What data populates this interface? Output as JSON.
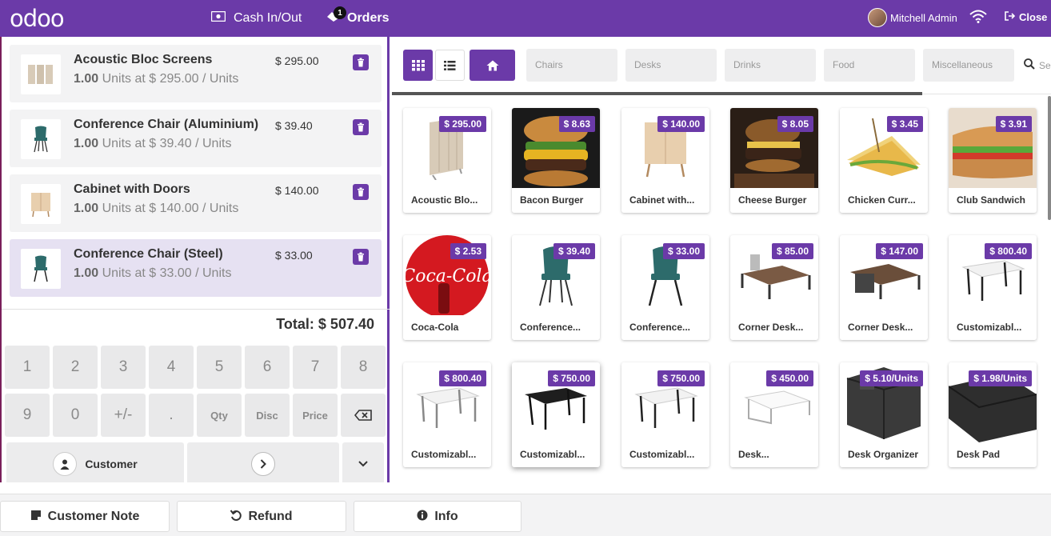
{
  "header": {
    "logo": "odoo",
    "cash_label": "Cash In/Out",
    "orders_label": "Orders",
    "orders_count": "1",
    "user_name": "Mitchell Admin",
    "close_label": "Close"
  },
  "order": {
    "lines": [
      {
        "name": "Acoustic Bloc Screens",
        "qty": "1.00",
        "unit_text": "Units at $ 295.00 / Units",
        "price": "$ 295.00",
        "selected": false
      },
      {
        "name": "Conference Chair (Aluminium)",
        "qty": "1.00",
        "unit_text": "Units at $ 39.40 / Units",
        "price": "$ 39.40",
        "selected": false
      },
      {
        "name": "Cabinet with Doors",
        "qty": "1.00",
        "unit_text": "Units at $ 140.00 / Units",
        "price": "$ 140.00",
        "selected": false
      },
      {
        "name": "Conference Chair (Steel)",
        "qty": "1.00",
        "unit_text": "Units at $ 33.00 / Units",
        "price": "$ 33.00",
        "selected": true
      }
    ],
    "total": "Total: $ 507.40"
  },
  "numpad": {
    "row1": [
      "1",
      "2",
      "3",
      "4",
      "5",
      "6",
      "7",
      "8"
    ],
    "row2": [
      "9",
      "0",
      "+/-",
      ".",
      "Qty",
      "Disc",
      "Price"
    ],
    "customer_label": "Customer"
  },
  "bottom": {
    "note_label": "Customer Note",
    "refund_label": "Refund",
    "info_label": "Info"
  },
  "categories": [
    "Chairs",
    "Desks",
    "Drinks",
    "Food",
    "Miscellaneous"
  ],
  "search_placeholder": "Se",
  "products": [
    {
      "name": "Acoustic Blo...",
      "price": "$ 295.00",
      "icon": "screen-icon"
    },
    {
      "name": "Bacon Burger",
      "price": "$ 8.63",
      "icon": "burger-icon"
    },
    {
      "name": "Cabinet with...",
      "price": "$ 140.00",
      "icon": "cabinet-icon"
    },
    {
      "name": "Cheese Burger",
      "price": "$ 8.05",
      "icon": "burger-icon"
    },
    {
      "name": "Chicken Curr...",
      "price": "$ 3.45",
      "icon": "sandwich-icon"
    },
    {
      "name": "Club Sandwich",
      "price": "$ 3.91",
      "icon": "sandwich-icon"
    },
    {
      "name": "Coca-Cola",
      "price": "$ 2.53",
      "icon": "cola-icon"
    },
    {
      "name": "Conference...",
      "price": "$ 39.40",
      "icon": "chair-icon"
    },
    {
      "name": "Conference...",
      "price": "$ 33.00",
      "icon": "chair-icon"
    },
    {
      "name": "Corner Desk...",
      "price": "$ 85.00",
      "icon": "desk-icon"
    },
    {
      "name": "Corner Desk...",
      "price": "$ 147.00",
      "icon": "desk-icon"
    },
    {
      "name": "Customizabl...",
      "price": "$ 800.40",
      "icon": "table-icon"
    },
    {
      "name": "Customizabl...",
      "price": "$ 800.40",
      "icon": "table-icon"
    },
    {
      "name": "Customizabl...",
      "price": "$ 750.00",
      "icon": "table-icon"
    },
    {
      "name": "Customizabl...",
      "price": "$ 750.00",
      "icon": "table-icon"
    },
    {
      "name": "Desk...",
      "price": "$ 450.00",
      "icon": "desk-icon"
    },
    {
      "name": "Desk Organizer",
      "price": "$ 5.10/Units",
      "icon": "organizer-icon"
    },
    {
      "name": "Desk Pad",
      "price": "$ 1.98/Units",
      "icon": "pad-icon"
    }
  ],
  "colors": {
    "brand": "#6b3aa8",
    "total_text": "#333333"
  }
}
